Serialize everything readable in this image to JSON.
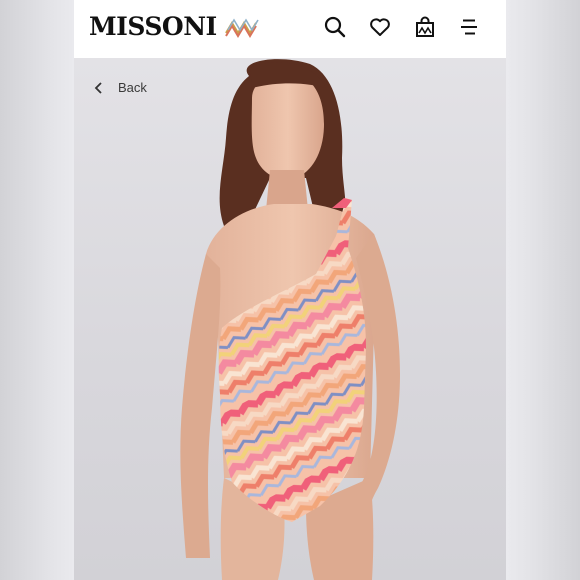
{
  "header": {
    "brand": "MISSONI",
    "icons": [
      "search-icon",
      "heart-icon",
      "shopping-bag-icon",
      "menu-icon"
    ]
  },
  "nav": {
    "back_label": "Back"
  },
  "colors": {
    "header_bg": "#ffffff",
    "photo_bg": "#dddce1",
    "swimsuit_pink": "#f0607a",
    "swimsuit_orange": "#f2a67a",
    "swimsuit_blue": "#7f8fc4",
    "swimsuit_yellow": "#f2d27a"
  }
}
